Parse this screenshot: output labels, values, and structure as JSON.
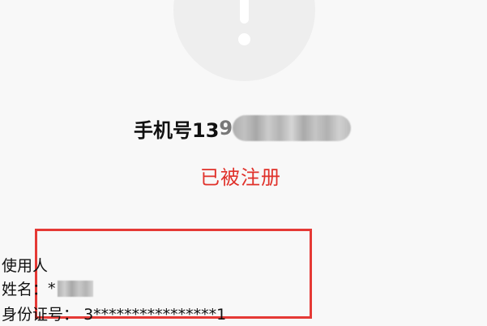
{
  "alert": {
    "icon": "exclamation-icon"
  },
  "phone": {
    "label": "手机号13",
    "visible_digit": "9"
  },
  "status": {
    "text": "已被注册",
    "color": "#e0312a"
  },
  "user_info": {
    "title": "使用人",
    "name_label": "姓名：",
    "name_value": "*",
    "id_label": "身份证号：",
    "id_value": "3****************1"
  },
  "colors": {
    "highlight_border": "#e53935",
    "background": "#f8f8f8"
  }
}
